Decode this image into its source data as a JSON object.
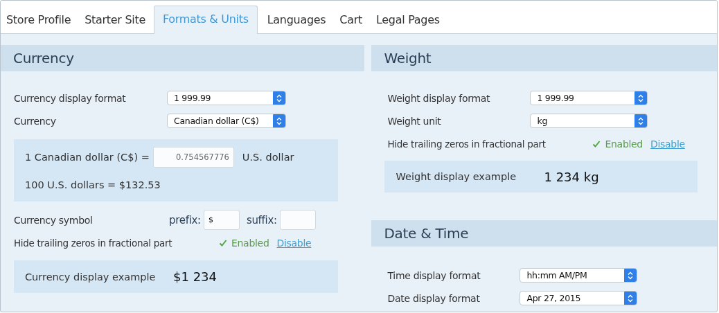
{
  "tabs": [
    {
      "label": "Store Profile",
      "selected": false
    },
    {
      "label": "Starter Site",
      "selected": false
    },
    {
      "label": "Formats & Units",
      "selected": true
    },
    {
      "label": "Languages",
      "selected": false
    },
    {
      "label": "Cart",
      "selected": false
    },
    {
      "label": "Legal Pages",
      "selected": false
    }
  ],
  "columns": [
    {
      "sections": [
        {
          "title": "Currency",
          "rows": [
            {
              "kind": "select",
              "label": "Currency display format",
              "value": "1 999.99"
            },
            {
              "kind": "select",
              "label": "Currency",
              "value": "Canadian dollar (C$)"
            },
            {
              "kind": "rate",
              "lead": "1 Canadian dollar (C$) =",
              "value": "0.754567776",
              "unit": "U.S. dollar",
              "note": "100 U.S. dollars = $132.53"
            },
            {
              "kind": "symbol",
              "label": "Currency symbol",
              "prefix_label": "prefix:",
              "prefix": "$",
              "suffix_label": "suffix:"
            },
            {
              "kind": "toggle",
              "label": "Hide trailing zeros in fractional part",
              "enabled": true,
              "status": "Enabled",
              "action": "Disable"
            },
            {
              "kind": "example",
              "label": "Currency display example",
              "value": "$1 234"
            }
          ]
        }
      ]
    },
    {
      "sections": [
        {
          "title": "Weight",
          "rows": [
            {
              "kind": "select",
              "label": "Weight display format",
              "value": "1 999.99"
            },
            {
              "kind": "select",
              "label": "Weight unit",
              "value": "kg"
            },
            {
              "kind": "toggle",
              "label": "Hide trailing zeros in fractional part",
              "enabled": true,
              "status": "Enabled",
              "action": "Disable"
            },
            {
              "kind": "example",
              "label": "Weight display example",
              "value": "1 234 kg"
            }
          ]
        },
        {
          "title": "Date & Time",
          "rows": [
            {
              "kind": "select",
              "label": "Time display format",
              "value": "hh:mm AM/PM"
            },
            {
              "kind": "select",
              "label": "Date display format",
              "value": "Apr 27, 2015"
            }
          ]
        }
      ]
    }
  ]
}
